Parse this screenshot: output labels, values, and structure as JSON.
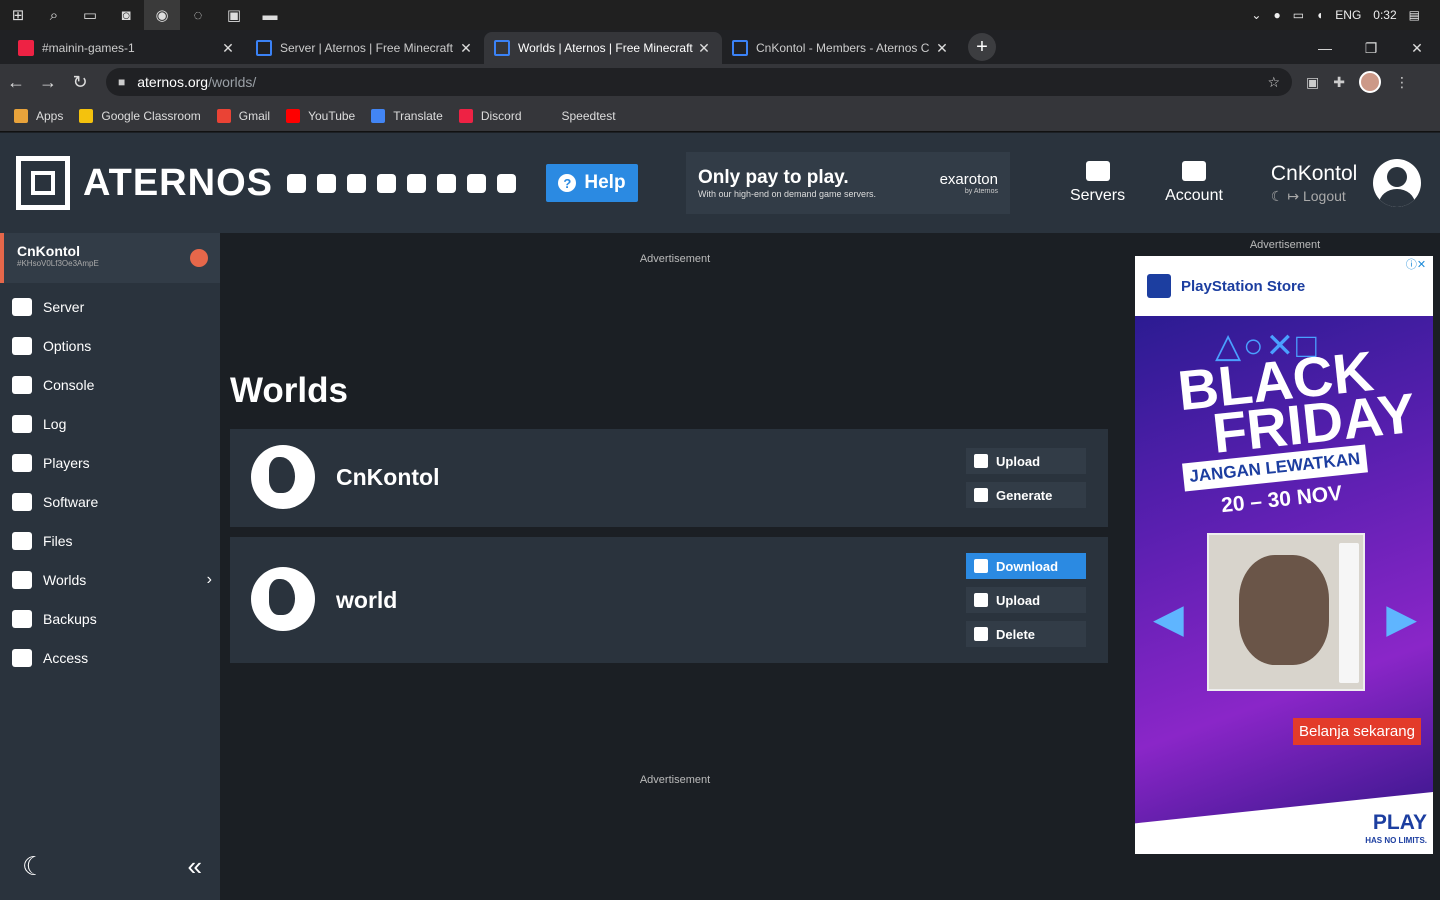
{
  "taskbar": {
    "lang": "ENG",
    "time": "0:32"
  },
  "browser": {
    "tabs": [
      {
        "title": "#mainin-games-1",
        "active": false
      },
      {
        "title": "Server | Aternos | Free Minecraft",
        "active": false
      },
      {
        "title": "Worlds | Aternos | Free Minecraft",
        "active": true
      },
      {
        "title": "CnKontol - Members - Aternos C",
        "active": false
      }
    ],
    "url_host": "aternos.org",
    "url_path": "/worlds/",
    "bookmarks": [
      "Apps",
      "Google Classroom",
      "Gmail",
      "YouTube",
      "Translate",
      "Discord",
      "Speedtest"
    ]
  },
  "header": {
    "logo_text": "ATERNOS",
    "help_label": "Help",
    "promo_title": "Only pay to play.",
    "promo_sub": "With our high-end on demand game servers.",
    "promo_brand": "exaroton",
    "promo_brand_sub": "by Aternos",
    "nav_servers": "Servers",
    "nav_account": "Account",
    "username": "CnKontol",
    "logout": "Logout"
  },
  "sidebar": {
    "server_name": "CnKontol",
    "server_id": "#KHsoV0Lf3Oe3AmpE",
    "items": [
      {
        "label": "Server"
      },
      {
        "label": "Options"
      },
      {
        "label": "Console"
      },
      {
        "label": "Log"
      },
      {
        "label": "Players"
      },
      {
        "label": "Software"
      },
      {
        "label": "Files"
      },
      {
        "label": "Worlds"
      },
      {
        "label": "Backups"
      },
      {
        "label": "Access"
      }
    ]
  },
  "main": {
    "ad_label": "Advertisement",
    "title": "Worlds",
    "worlds": [
      {
        "name": "CnKontol",
        "buttons": [
          "Upload",
          "Generate"
        ]
      },
      {
        "name": "world",
        "buttons": [
          "Download",
          "Upload",
          "Delete"
        ]
      }
    ]
  },
  "right_ad": {
    "label": "Advertisement",
    "store": "PlayStation Store",
    "shapes": "△○✕□",
    "headline1": "BLACK",
    "headline2": "FRIDAY",
    "tagline": "JANGAN LEWATKAN",
    "dates": "20 – 30 NOV",
    "cta": "Belanja sekarang",
    "play": "PLAY",
    "play_sub": "HAS NO LIMITS."
  }
}
